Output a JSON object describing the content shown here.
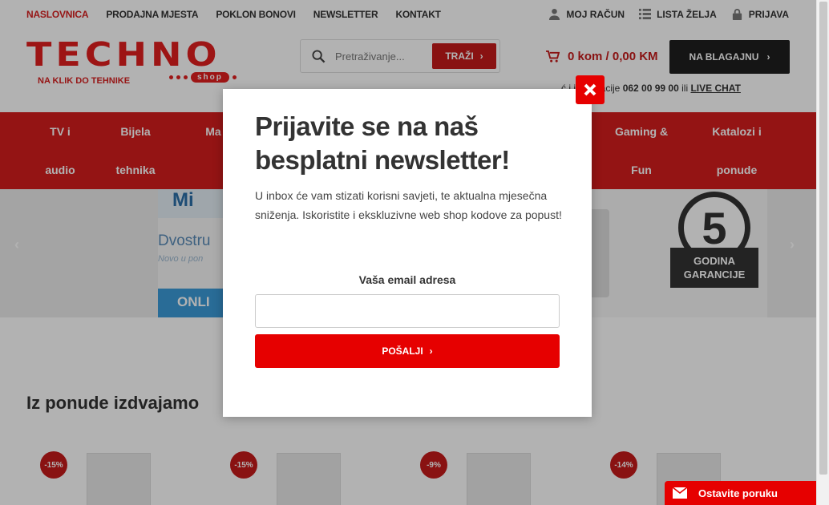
{
  "topnav": {
    "items": [
      "NASLOVNICA",
      "PRODAJNA MJESTA",
      "POKLON BONOVI",
      "NEWSLETTER",
      "KONTAKT"
    ]
  },
  "account": {
    "my_account": "MOJ RAČUN",
    "wishlist": "LISTA ŽELJA",
    "login": "PRIJAVA"
  },
  "logo": {
    "word": "TECHNO",
    "tagline": "NA KLIK DO TEHNIKE",
    "shop": "shop"
  },
  "search": {
    "placeholder": "Pretraživanje...",
    "button": "TRAŽI"
  },
  "cart": {
    "summary": "0 kom / 0,00 KM",
    "checkout": "NA BLAGAJNU"
  },
  "info": {
    "prefix": "ć i informacije",
    "phone": "062 00 99 00",
    "or": "ili",
    "chat": "LIVE CHAT"
  },
  "categories": [
    {
      "line1": "TV i",
      "line2": "audio"
    },
    {
      "line1": "Bijela",
      "line2": "tehnika"
    },
    {
      "line1": "Ma",
      "line2": ""
    },
    {
      "line1": "Gaming &",
      "line2": "Fun"
    },
    {
      "line1": "Katalozi i",
      "line2": "ponude"
    }
  ],
  "banner": {
    "t1": "Mi",
    "t2": "Dvostru",
    "t3": "Novo u pon",
    "t4": "ONLI",
    "badge_number": "5",
    "badge_text": "GODINA GARANCIJE"
  },
  "section": {
    "title": "Iz ponude izdvajamo"
  },
  "products": [
    {
      "discount": "-15%"
    },
    {
      "discount": "-15%"
    },
    {
      "discount": "-9%"
    },
    {
      "discount": "-14%"
    }
  ],
  "chat_widget": {
    "label": "Ostavite poruku"
  },
  "modal": {
    "title": "Prijavite se na naš besplatni newsletter!",
    "text": "U inbox će vam stizati korisni savjeti, te aktualna mjesečna sniženja. Iskoristite i ekskluzivne web shop kodove za popust!",
    "email_label": "Vaša email adresa",
    "submit": "POŠALJI"
  },
  "colors": {
    "brand_red": "#e11f1f",
    "dark": "#1f1f1f"
  }
}
